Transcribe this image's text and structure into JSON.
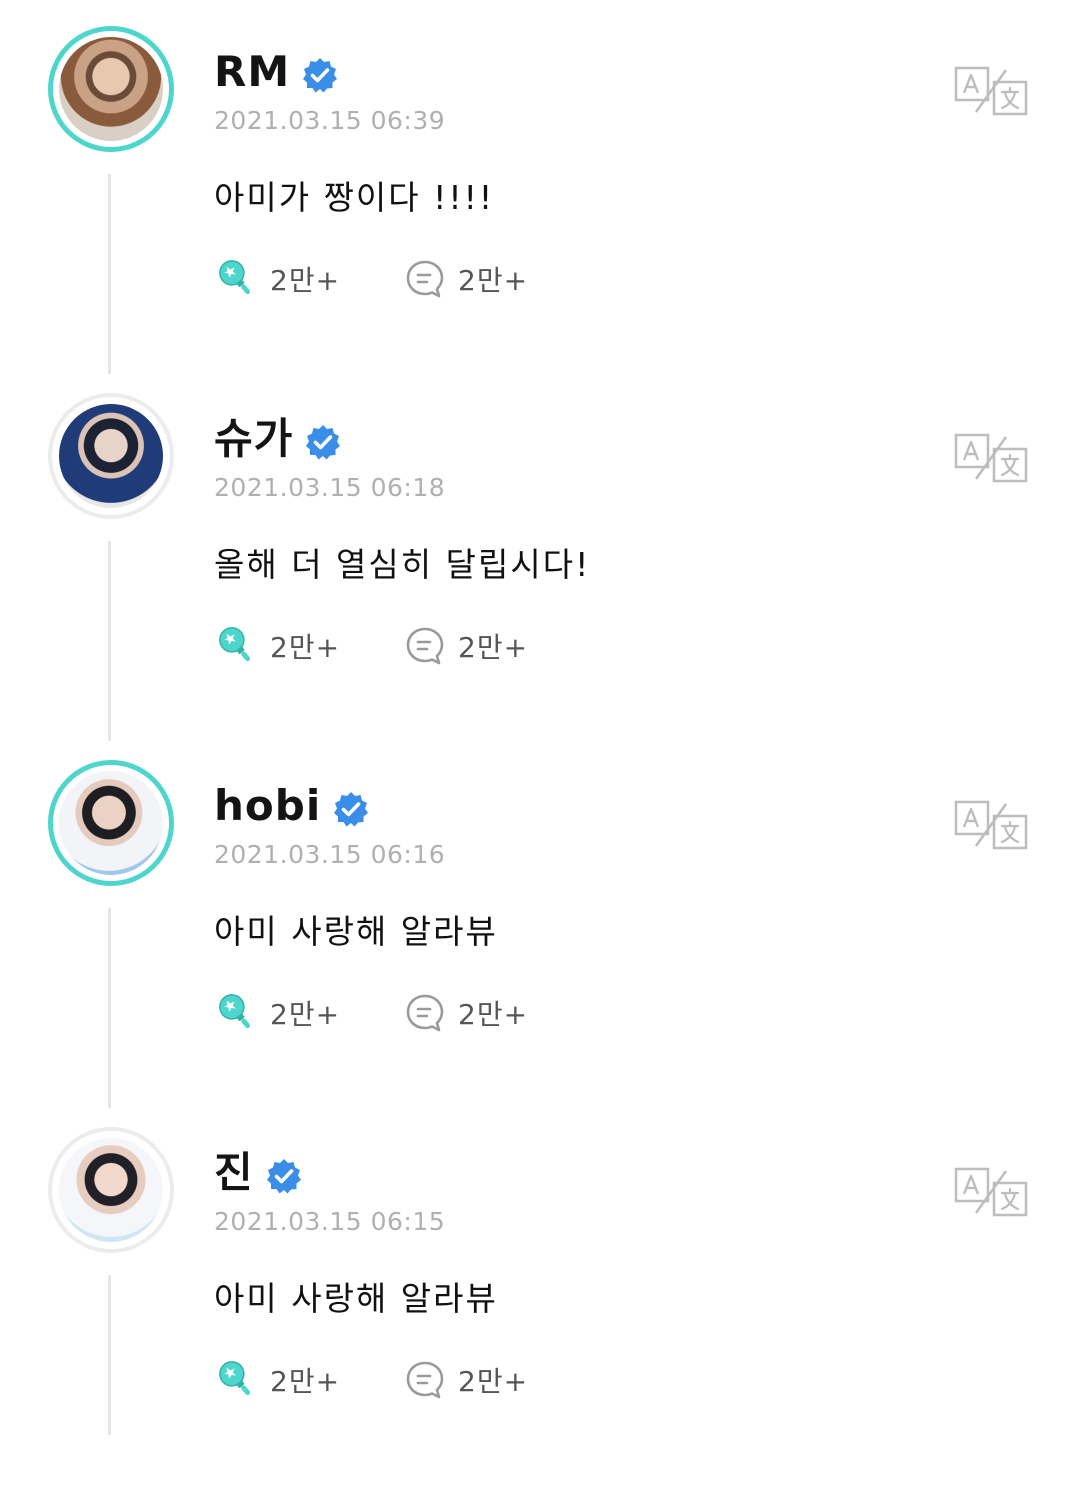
{
  "colors": {
    "accent": "#4fd6cc",
    "verified": "#3a8ee8",
    "timestamp": "#b0b0b0",
    "thread_line": "#e6e6e6"
  },
  "icons": {
    "verified": "verified-badge-icon",
    "cheer": "light-stick-icon",
    "comment": "comment-bubble-icon",
    "translate": "translate-icon"
  },
  "posts": [
    {
      "author": "RM",
      "verified": true,
      "avatar_ring_active": true,
      "timestamp": "2021.03.15 06:39",
      "message": "아미가 짱이다 !!!!",
      "likes": "2만+",
      "comments": "2만+"
    },
    {
      "author": "슈가",
      "verified": true,
      "avatar_ring_active": false,
      "timestamp": "2021.03.15 06:18",
      "message": "올해 더 열심히 달립시다!",
      "likes": "2만+",
      "comments": "2만+"
    },
    {
      "author": "hobi",
      "verified": true,
      "avatar_ring_active": true,
      "timestamp": "2021.03.15 06:16",
      "message": "아미 사랑해 알라뷰",
      "likes": "2만+",
      "comments": "2만+"
    },
    {
      "author": "진",
      "verified": true,
      "avatar_ring_active": false,
      "timestamp": "2021.03.15 06:15",
      "message": "아미 사랑해 알라뷰",
      "likes": "2만+",
      "comments": "2만+"
    }
  ]
}
